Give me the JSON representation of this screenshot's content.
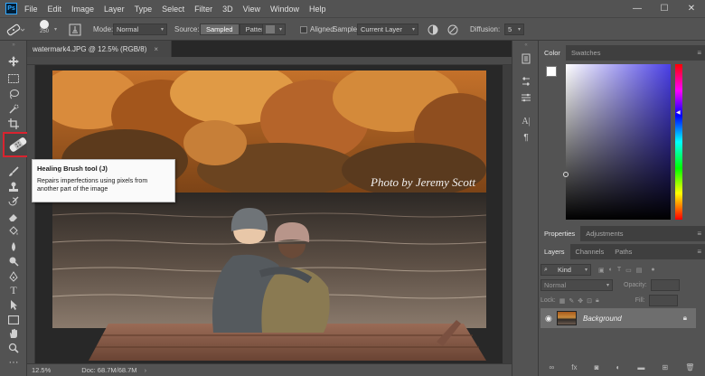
{
  "app": {
    "logo": "Ps"
  },
  "menu": [
    "File",
    "Edit",
    "Image",
    "Layer",
    "Type",
    "Select",
    "Filter",
    "3D",
    "View",
    "Window",
    "Help"
  ],
  "window_controls": {
    "minimize": "—",
    "maximize": "☐",
    "close": "✕"
  },
  "options": {
    "brush_size": "250",
    "mode_label": "Mode:",
    "mode_value": "Normal",
    "source_label": "Source:",
    "source_sampled": "Sampled",
    "source_pattern": "Pattern",
    "aligned_label": "Aligned",
    "sample_label": "Sample:",
    "sample_value": "Current Layer",
    "diffusion_label": "Diffusion:",
    "diffusion_value": "5"
  },
  "document": {
    "tab_title": "watermark4.JPG @ 12.5% (RGB/8)",
    "close_glyph": "×",
    "zoom": "12.5%",
    "doc_info": "Doc: 68.7M/68.7M",
    "watermark_text": "Photo by Jeremy Scott"
  },
  "tooltip": {
    "title": "Healing Brush tool (J)",
    "description": "Repairs imperfections using pixels from another part of the image"
  },
  "panels": {
    "color_tabs": [
      "Color",
      "Swatches"
    ],
    "properties_tabs": [
      "Properties",
      "Adjustments"
    ],
    "layers_tabs": [
      "Layers",
      "Channels",
      "Paths"
    ],
    "kind_label": "Kind",
    "blend_mode": "Normal",
    "opacity_label": "Opacity:",
    "lock_label": "Lock:",
    "fill_label": "Fill:",
    "layer_name": "Background"
  },
  "colors": {
    "accent_red": "#d9232f",
    "ps_blue": "#31a8ff",
    "panel_bg": "#535353"
  }
}
